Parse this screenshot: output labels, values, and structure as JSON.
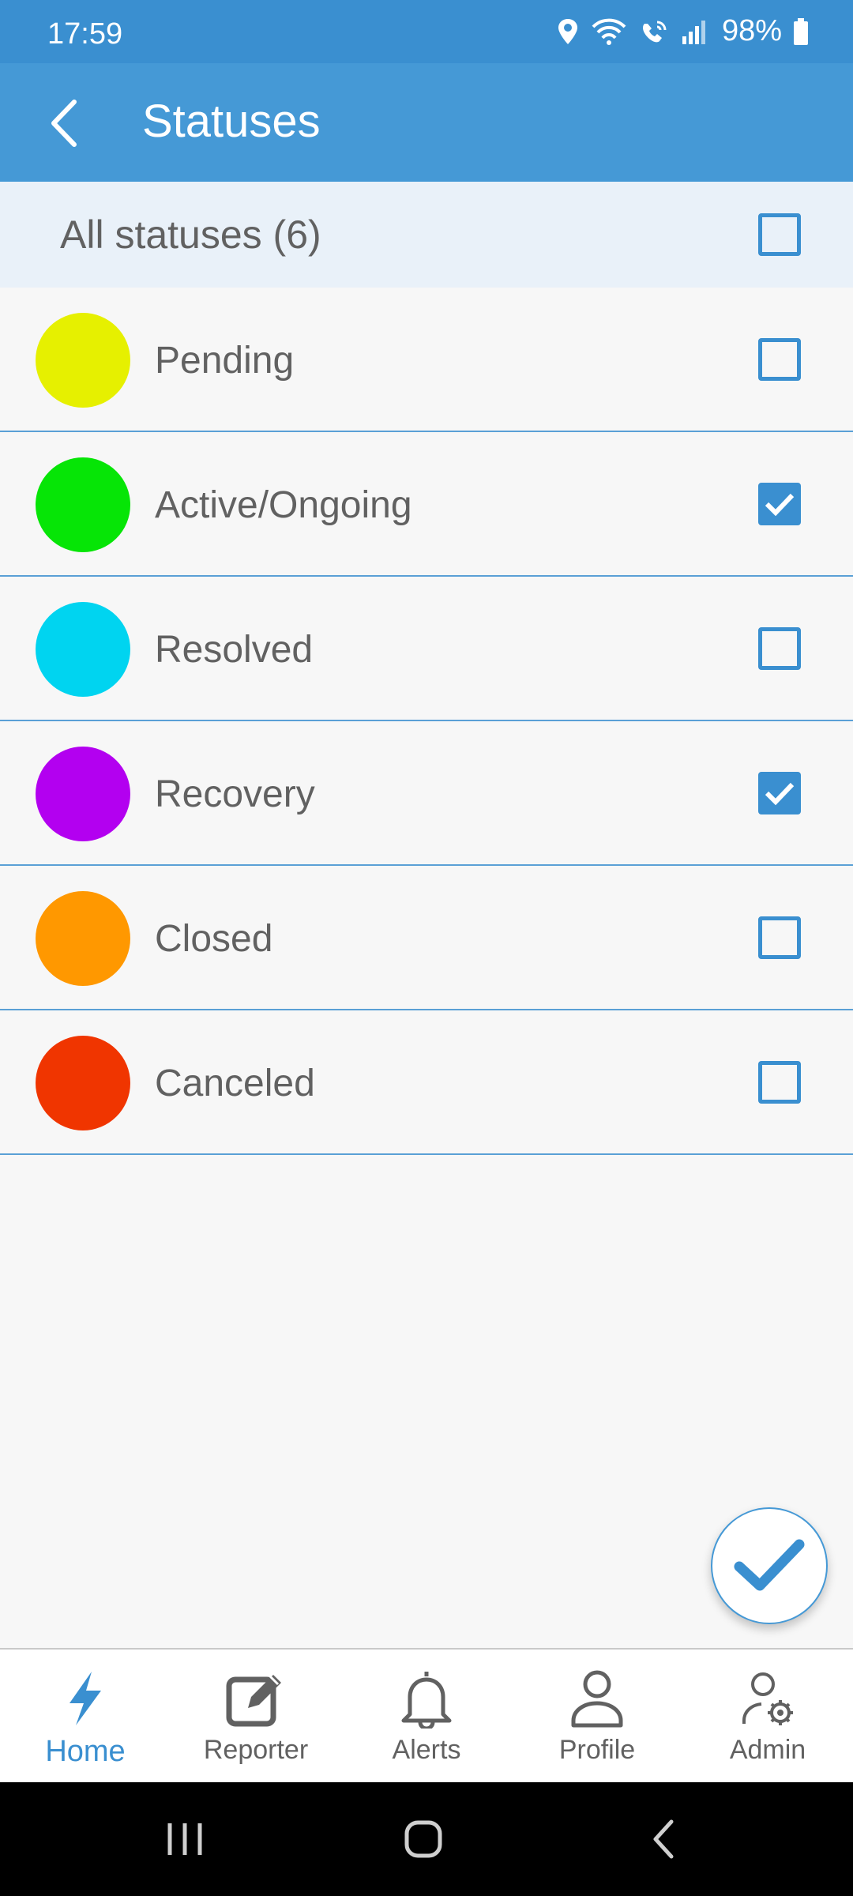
{
  "status_bar": {
    "time": "17:59",
    "battery": "98%"
  },
  "header": {
    "title": "Statuses"
  },
  "all_statuses": {
    "label": "All statuses (6)",
    "checked": false
  },
  "statuses": [
    {
      "label": "Pending",
      "color": "#e6f000",
      "checked": false
    },
    {
      "label": "Active/Ongoing",
      "color": "#06e506",
      "checked": true
    },
    {
      "label": "Resolved",
      "color": "#00d4f0",
      "checked": false
    },
    {
      "label": "Recovery",
      "color": "#b300f0",
      "checked": true
    },
    {
      "label": "Closed",
      "color": "#ff9800",
      "checked": false
    },
    {
      "label": "Canceled",
      "color": "#f03500",
      "checked": false
    }
  ],
  "bottom_nav": {
    "items": [
      {
        "label": "Home",
        "icon": "lightning-icon",
        "active": true
      },
      {
        "label": "Reporter",
        "icon": "edit-icon",
        "active": false
      },
      {
        "label": "Alerts",
        "icon": "bell-icon",
        "active": false
      },
      {
        "label": "Profile",
        "icon": "person-icon",
        "active": false
      },
      {
        "label": "Admin",
        "icon": "admin-gear-icon",
        "active": false
      }
    ]
  },
  "colors": {
    "primary": "#3a8fd0",
    "app_bar": "#4599d6",
    "header_row": "#e9f1f9"
  }
}
